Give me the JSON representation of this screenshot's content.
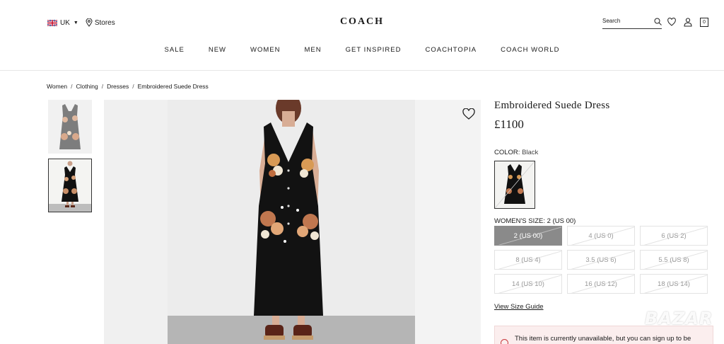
{
  "header": {
    "region": "UK",
    "stores": "Stores",
    "logo": "COACH",
    "search_placeholder": "Search",
    "nav": [
      "SALE",
      "NEW",
      "WOMEN",
      "MEN",
      "GET INSPIRED",
      "COACHTOPIA",
      "COACH WORLD"
    ],
    "bag_count": "0"
  },
  "breadcrumb": [
    "Women",
    "Clothing",
    "Dresses",
    "Embroidered Suede Dress"
  ],
  "product": {
    "title": "Embroidered Suede Dress",
    "price": "£1100",
    "color_label": "COLOR:",
    "color_value": "Black",
    "size_label": "WOMEN'S SIZE:",
    "size_value": "2 (US 00)",
    "sizes": [
      "2 (US 00)",
      "4 (US 0)",
      "6 (US 2)",
      "8 (US 4)",
      "3.5 (US 6)",
      "5.5 (US 8)",
      "14 (US 10)",
      "16 (US 12)",
      "18 (US 14)"
    ],
    "selected_size": "2 (US 00)",
    "size_guide": "View Size Guide",
    "notice": "This item is currently unavailable, but you can sign up to be"
  },
  "watermark": "BAZAR",
  "colors": {
    "accent": "#1a1a1a",
    "selected_size": "#8a8a8a",
    "notice_bg": "#fbeeee"
  }
}
